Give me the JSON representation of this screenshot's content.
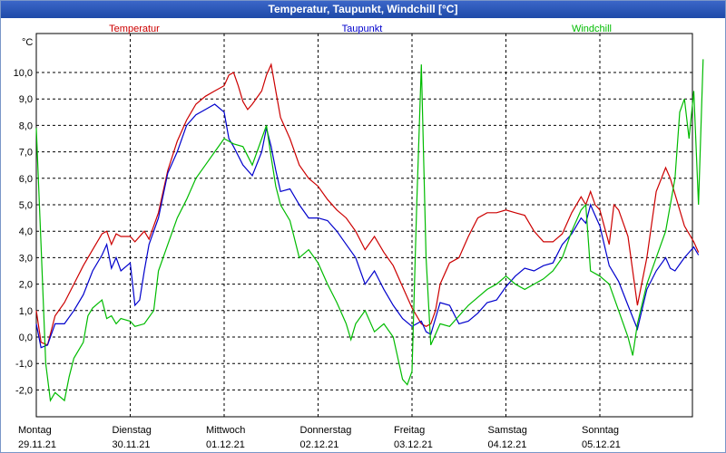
{
  "window": {
    "title": "Temperatur, Taupunkt, Windchill [°C]"
  },
  "chart_data": {
    "type": "line",
    "title": "Temperatur, Taupunkt, Windchill [°C]",
    "ylabel": "°C",
    "ylim": [
      -3,
      11
    ],
    "yticks": [
      "-2,0",
      "-1,0",
      "0,0",
      "1,0",
      "2,0",
      "3,0",
      "4,0",
      "5,0",
      "6,0",
      "7,0",
      "8,0",
      "9,0",
      "10,0"
    ],
    "xlim": [
      0,
      7
    ],
    "day_labels": [
      {
        "day": "Montag",
        "date": "29.11.21"
      },
      {
        "day": "Dienstag",
        "date": "30.11.21"
      },
      {
        "day": "Mittwoch",
        "date": "01.12.21"
      },
      {
        "day": "Donnerstag",
        "date": "02.12.21"
      },
      {
        "day": "Freitag",
        "date": "03.12.21"
      },
      {
        "day": "Samstag",
        "date": "04.12.21"
      },
      {
        "day": "Sonntag",
        "date": "05.12.21"
      }
    ],
    "grid": true,
    "series": [
      {
        "name": "Temperatur",
        "color": "#cc0000",
        "points": [
          [
            0,
            1.0
          ],
          [
            0.05,
            -0.2
          ],
          [
            0.12,
            -0.3
          ],
          [
            0.2,
            0.8
          ],
          [
            0.3,
            1.3
          ],
          [
            0.4,
            2.0
          ],
          [
            0.5,
            2.7
          ],
          [
            0.6,
            3.3
          ],
          [
            0.7,
            3.9
          ],
          [
            0.75,
            4.0
          ],
          [
            0.8,
            3.5
          ],
          [
            0.85,
            3.9
          ],
          [
            0.9,
            3.8
          ],
          [
            1.0,
            3.8
          ],
          [
            1.05,
            3.6
          ],
          [
            1.15,
            4.0
          ],
          [
            1.2,
            3.7
          ],
          [
            1.3,
            4.7
          ],
          [
            1.4,
            6.3
          ],
          [
            1.5,
            7.4
          ],
          [
            1.6,
            8.2
          ],
          [
            1.7,
            8.8
          ],
          [
            1.8,
            9.1
          ],
          [
            1.9,
            9.3
          ],
          [
            2.0,
            9.5
          ],
          [
            2.05,
            9.9
          ],
          [
            2.1,
            10.0
          ],
          [
            2.15,
            9.5
          ],
          [
            2.2,
            8.9
          ],
          [
            2.25,
            8.6
          ],
          [
            2.3,
            8.8
          ],
          [
            2.4,
            9.3
          ],
          [
            2.45,
            9.9
          ],
          [
            2.5,
            10.3
          ],
          [
            2.55,
            9.3
          ],
          [
            2.6,
            8.3
          ],
          [
            2.7,
            7.5
          ],
          [
            2.8,
            6.5
          ],
          [
            2.9,
            6.0
          ],
          [
            3.0,
            5.7
          ],
          [
            3.1,
            5.2
          ],
          [
            3.2,
            4.8
          ],
          [
            3.3,
            4.5
          ],
          [
            3.4,
            4.0
          ],
          [
            3.5,
            3.3
          ],
          [
            3.6,
            3.8
          ],
          [
            3.7,
            3.2
          ],
          [
            3.8,
            2.7
          ],
          [
            3.9,
            1.9
          ],
          [
            4.0,
            1.1
          ],
          [
            4.1,
            0.5
          ],
          [
            4.15,
            0.4
          ],
          [
            4.2,
            0.5
          ],
          [
            4.25,
            1.0
          ],
          [
            4.3,
            2.0
          ],
          [
            4.4,
            2.8
          ],
          [
            4.5,
            3.0
          ],
          [
            4.6,
            3.8
          ],
          [
            4.7,
            4.5
          ],
          [
            4.8,
            4.7
          ],
          [
            4.9,
            4.7
          ],
          [
            5.0,
            4.8
          ],
          [
            5.1,
            4.7
          ],
          [
            5.2,
            4.6
          ],
          [
            5.3,
            4.0
          ],
          [
            5.4,
            3.6
          ],
          [
            5.5,
            3.6
          ],
          [
            5.6,
            3.9
          ],
          [
            5.7,
            4.7
          ],
          [
            5.8,
            5.3
          ],
          [
            5.85,
            5.0
          ],
          [
            5.9,
            5.5
          ],
          [
            5.95,
            5.0
          ],
          [
            6.0,
            4.8
          ],
          [
            6.1,
            3.5
          ],
          [
            6.15,
            5.0
          ],
          [
            6.2,
            4.8
          ],
          [
            6.3,
            3.8
          ],
          [
            6.4,
            1.2
          ],
          [
            6.5,
            3.0
          ],
          [
            6.6,
            5.5
          ],
          [
            6.7,
            6.4
          ],
          [
            6.75,
            6.0
          ],
          [
            6.8,
            5.4
          ],
          [
            6.9,
            4.2
          ],
          [
            7.0,
            3.6
          ],
          [
            7.05,
            3.2
          ]
        ]
      },
      {
        "name": "Taupunkt",
        "color": "#0000cc",
        "points": [
          [
            0,
            0.5
          ],
          [
            0.05,
            -0.4
          ],
          [
            0.12,
            -0.3
          ],
          [
            0.2,
            0.5
          ],
          [
            0.3,
            0.5
          ],
          [
            0.4,
            1.0
          ],
          [
            0.5,
            1.6
          ],
          [
            0.6,
            2.5
          ],
          [
            0.7,
            3.1
          ],
          [
            0.75,
            3.5
          ],
          [
            0.8,
            2.6
          ],
          [
            0.85,
            3.0
          ],
          [
            0.9,
            2.5
          ],
          [
            1.0,
            2.8
          ],
          [
            1.05,
            1.2
          ],
          [
            1.1,
            1.4
          ],
          [
            1.15,
            2.5
          ],
          [
            1.2,
            3.5
          ],
          [
            1.3,
            4.5
          ],
          [
            1.4,
            6.2
          ],
          [
            1.5,
            7.0
          ],
          [
            1.6,
            8.0
          ],
          [
            1.7,
            8.4
          ],
          [
            1.8,
            8.6
          ],
          [
            1.9,
            8.8
          ],
          [
            2.0,
            8.5
          ],
          [
            2.05,
            7.5
          ],
          [
            2.1,
            7.2
          ],
          [
            2.2,
            6.5
          ],
          [
            2.3,
            6.1
          ],
          [
            2.4,
            7.0
          ],
          [
            2.45,
            7.9
          ],
          [
            2.5,
            7.2
          ],
          [
            2.55,
            6.3
          ],
          [
            2.6,
            5.5
          ],
          [
            2.7,
            5.6
          ],
          [
            2.8,
            5.0
          ],
          [
            2.9,
            4.5
          ],
          [
            3.0,
            4.5
          ],
          [
            3.1,
            4.4
          ],
          [
            3.2,
            4.0
          ],
          [
            3.3,
            3.5
          ],
          [
            3.4,
            3.0
          ],
          [
            3.5,
            2.0
          ],
          [
            3.6,
            2.5
          ],
          [
            3.7,
            1.8
          ],
          [
            3.8,
            1.2
          ],
          [
            3.9,
            0.7
          ],
          [
            4.0,
            0.4
          ],
          [
            4.1,
            0.6
          ],
          [
            4.15,
            0.2
          ],
          [
            4.2,
            0.1
          ],
          [
            4.3,
            1.3
          ],
          [
            4.4,
            1.2
          ],
          [
            4.5,
            0.5
          ],
          [
            4.6,
            0.6
          ],
          [
            4.7,
            0.9
          ],
          [
            4.8,
            1.3
          ],
          [
            4.9,
            1.4
          ],
          [
            5.0,
            1.9
          ],
          [
            5.1,
            2.3
          ],
          [
            5.2,
            2.6
          ],
          [
            5.3,
            2.5
          ],
          [
            5.4,
            2.7
          ],
          [
            5.5,
            2.8
          ],
          [
            5.6,
            3.5
          ],
          [
            5.7,
            3.9
          ],
          [
            5.8,
            4.5
          ],
          [
            5.85,
            4.3
          ],
          [
            5.9,
            5.0
          ],
          [
            5.95,
            4.6
          ],
          [
            6.0,
            4.2
          ],
          [
            6.1,
            2.7
          ],
          [
            6.2,
            2.1
          ],
          [
            6.3,
            1.2
          ],
          [
            6.4,
            0.3
          ],
          [
            6.5,
            1.8
          ],
          [
            6.6,
            2.5
          ],
          [
            6.7,
            3.0
          ],
          [
            6.75,
            2.6
          ],
          [
            6.8,
            2.5
          ],
          [
            6.9,
            3.0
          ],
          [
            7.0,
            3.4
          ],
          [
            7.05,
            3.1
          ]
        ]
      },
      {
        "name": "Windchill",
        "color": "#00bb00",
        "points": [
          [
            0,
            7.9
          ],
          [
            0.05,
            3.5
          ],
          [
            0.1,
            -1.0
          ],
          [
            0.15,
            -2.4
          ],
          [
            0.2,
            -2.1
          ],
          [
            0.3,
            -2.4
          ],
          [
            0.35,
            -1.5
          ],
          [
            0.4,
            -0.8
          ],
          [
            0.5,
            -0.2
          ],
          [
            0.55,
            0.8
          ],
          [
            0.6,
            1.1
          ],
          [
            0.7,
            1.4
          ],
          [
            0.75,
            0.7
          ],
          [
            0.8,
            0.8
          ],
          [
            0.85,
            0.5
          ],
          [
            0.9,
            0.7
          ],
          [
            1.0,
            0.6
          ],
          [
            1.05,
            0.4
          ],
          [
            1.15,
            0.5
          ],
          [
            1.25,
            1.0
          ],
          [
            1.3,
            2.5
          ],
          [
            1.4,
            3.5
          ],
          [
            1.5,
            4.5
          ],
          [
            1.6,
            5.2
          ],
          [
            1.7,
            6.0
          ],
          [
            1.8,
            6.5
          ],
          [
            1.9,
            7.0
          ],
          [
            2.0,
            7.5
          ],
          [
            2.1,
            7.3
          ],
          [
            2.2,
            7.2
          ],
          [
            2.3,
            6.5
          ],
          [
            2.4,
            7.5
          ],
          [
            2.45,
            8.0
          ],
          [
            2.5,
            6.8
          ],
          [
            2.55,
            5.7
          ],
          [
            2.6,
            5.0
          ],
          [
            2.7,
            4.4
          ],
          [
            2.8,
            3.0
          ],
          [
            2.9,
            3.3
          ],
          [
            3.0,
            2.8
          ],
          [
            3.1,
            2.0
          ],
          [
            3.2,
            1.3
          ],
          [
            3.3,
            0.5
          ],
          [
            3.35,
            -0.1
          ],
          [
            3.4,
            0.5
          ],
          [
            3.5,
            1.0
          ],
          [
            3.6,
            0.2
          ],
          [
            3.7,
            0.5
          ],
          [
            3.8,
            0.0
          ],
          [
            3.9,
            -1.6
          ],
          [
            3.95,
            -1.8
          ],
          [
            4.0,
            -1.3
          ],
          [
            4.05,
            5.0
          ],
          [
            4.1,
            10.3
          ],
          [
            4.15,
            3.0
          ],
          [
            4.2,
            -0.3
          ],
          [
            4.3,
            0.5
          ],
          [
            4.4,
            0.4
          ],
          [
            4.5,
            0.8
          ],
          [
            4.6,
            1.2
          ],
          [
            4.7,
            1.5
          ],
          [
            4.8,
            1.8
          ],
          [
            4.9,
            2.0
          ],
          [
            5.0,
            2.3
          ],
          [
            5.1,
            2.0
          ],
          [
            5.2,
            1.8
          ],
          [
            5.3,
            2.0
          ],
          [
            5.4,
            2.2
          ],
          [
            5.5,
            2.5
          ],
          [
            5.6,
            3.0
          ],
          [
            5.7,
            4.0
          ],
          [
            5.8,
            4.8
          ],
          [
            5.85,
            5.0
          ],
          [
            5.9,
            2.5
          ],
          [
            6.0,
            2.3
          ],
          [
            6.1,
            2.0
          ],
          [
            6.2,
            1.0
          ],
          [
            6.3,
            0.0
          ],
          [
            6.35,
            -0.7
          ],
          [
            6.4,
            0.5
          ],
          [
            6.5,
            2.0
          ],
          [
            6.6,
            3.0
          ],
          [
            6.7,
            4.0
          ],
          [
            6.8,
            6.0
          ],
          [
            6.85,
            8.5
          ],
          [
            6.9,
            9.0
          ],
          [
            6.95,
            7.5
          ],
          [
            7.0,
            9.3
          ],
          [
            7.05,
            5.0
          ],
          [
            7.1,
            10.5
          ]
        ]
      }
    ]
  }
}
